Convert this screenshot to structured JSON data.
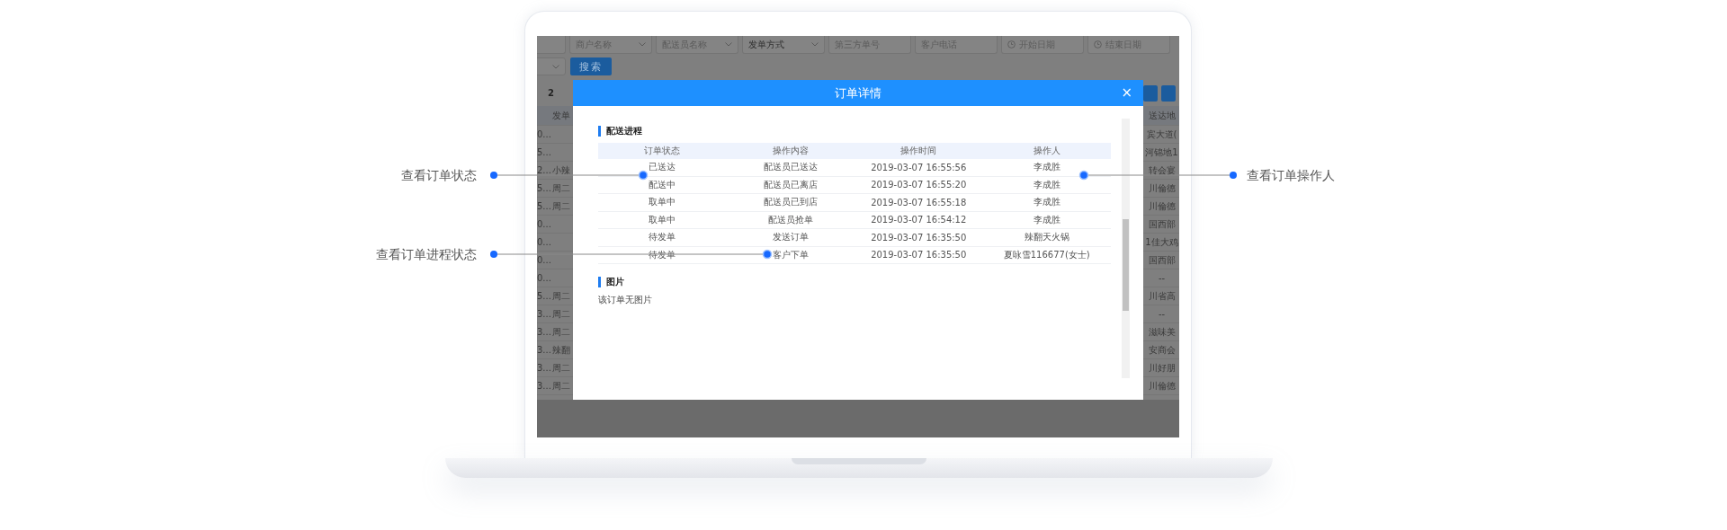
{
  "screen": {
    "filters": [
      {
        "kind": "select",
        "placeholder": "商户名称"
      },
      {
        "kind": "select",
        "placeholder": "配送员名称"
      },
      {
        "kind": "select",
        "value": "发单方式"
      },
      {
        "kind": "text",
        "placeholder": "第三方单号"
      },
      {
        "kind": "text",
        "placeholder": "客户电话"
      },
      {
        "kind": "date",
        "placeholder": "开始日期"
      },
      {
        "kind": "date",
        "placeholder": "结束日期"
      }
    ],
    "search_button": "搜索",
    "page_number": "2",
    "table": {
      "column_2_header": "发单",
      "right_column_header": "送达地",
      "rows": [
        {
          "column_1": "0...",
          "right_column": "宾大道("
        },
        {
          "column_1": "5...",
          "right_column": "河锦地1"
        },
        {
          "column_1": "2...",
          "column_2": "小辣",
          "right_column": "转会宴"
        },
        {
          "column_1": "5...",
          "column_2": "周二",
          "right_column": "川倫德"
        },
        {
          "column_1": "5...",
          "column_2": "周二",
          "right_column": "川倫德"
        },
        {
          "column_1": "0...",
          "right_column": "国西部"
        },
        {
          "column_1": "0...",
          "right_column": "1佳大鸡"
        },
        {
          "column_1": "0...",
          "right_column": "国西部"
        },
        {
          "column_1": "0...",
          "right_column": "--"
        },
        {
          "column_1": "5...",
          "column_2": "周二",
          "right_column": "川省高"
        },
        {
          "column_1": "3...",
          "column_2": "周二",
          "right_column": "--"
        },
        {
          "column_1": "3...",
          "column_2": "周二",
          "right_column": "滋味美"
        },
        {
          "column_1": "3...",
          "column_2": "辣翻",
          "right_column": "安商会"
        },
        {
          "column_1": "3...",
          "column_2": "周二",
          "right_column": "川好朋"
        },
        {
          "column_1": "3...",
          "column_2": "周二",
          "right_column": "川倫德"
        }
      ]
    }
  },
  "modal": {
    "title": "订单详情",
    "close": "×",
    "sections": [
      {
        "kind": "table",
        "title": "配送进程",
        "columns": [
          "订单状态",
          "操作内容",
          "操作时间",
          "操作人"
        ],
        "rows": [
          [
            "已送达",
            "配送员已送达",
            "2019-03-07 16:55:56",
            "李成胜"
          ],
          [
            "配送中",
            "配送员已离店",
            "2019-03-07 16:55:20",
            "李成胜"
          ],
          [
            "取单中",
            "配送员已到店",
            "2019-03-07 16:55:18",
            "李成胜"
          ],
          [
            "取单中",
            "配送员抢单",
            "2019-03-07 16:54:12",
            "李成胜"
          ],
          [
            "待发单",
            "发送订单",
            "2019-03-07 16:35:50",
            "辣翻天火锅"
          ],
          [
            "待发单",
            "客户下单",
            "2019-03-07 16:35:50",
            "夏咏雪116677(女士)"
          ]
        ]
      },
      {
        "kind": "text",
        "title": "图片",
        "text": "该订单无图片"
      }
    ]
  },
  "annotations": [
    {
      "label": "查看订单状态"
    },
    {
      "label": "查看订单进程状态"
    },
    {
      "label": "查看订单操作人"
    }
  ]
}
